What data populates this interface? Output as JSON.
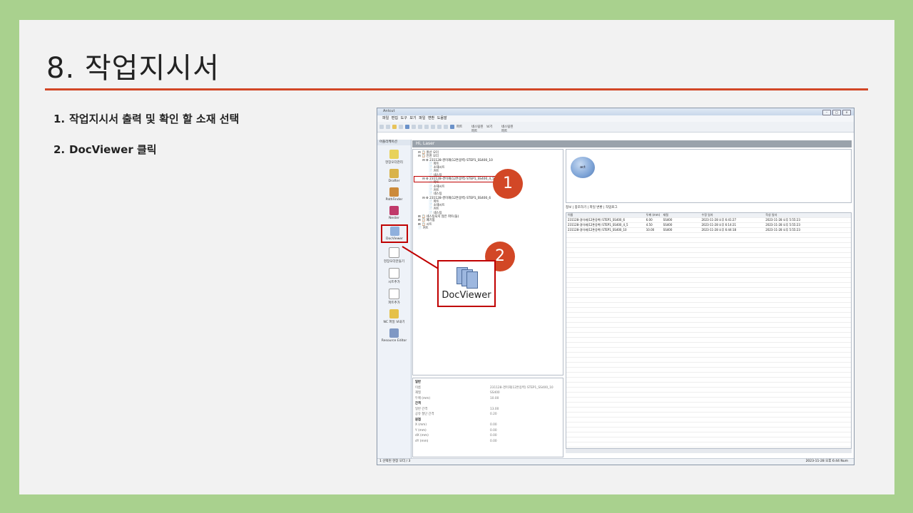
{
  "slide": {
    "title": "8. 작업지시서",
    "steps": [
      {
        "num": "1.",
        "text": "작업지시서 출력 및 확인 할 소재 선택"
      },
      {
        "num": "2.",
        "text": "DocViewer 클릭"
      }
    ]
  },
  "callouts": {
    "one": "1",
    "two": "2",
    "zoom_label": "DocViewer"
  },
  "window": {
    "title": "Antcut",
    "menu": "파일  편집  도구  보기  파일 변환  도움말",
    "toolbar_text": [
      "파트",
      "네스팅된 파트",
      "보기",
      "네스팅된 파트"
    ],
    "left_header": "어플리케이션",
    "apps": [
      "현장오더관리",
      "Drafter",
      "PathFinder",
      "Nester",
      "DocViewer",
      "현장오더만들기",
      "시트추가",
      "파트추가",
      "NC 파일 보내기",
      "Resource Editor"
    ],
    "banner": "Hi, Laser",
    "tree": [
      {
        "level": "l1",
        "text": "⊟ 📋 원산 오더"
      },
      {
        "level": "l1",
        "text": "⊟ 📋 인천 오더"
      },
      {
        "level": "l2",
        "text": "⊟ ⚙ 231128-경이재(12톤옹벽) STEP1_SS400_10"
      },
      {
        "level": "l3",
        "text": "📄 파트"
      },
      {
        "level": "l3",
        "text": "📄 소재시트"
      },
      {
        "level": "l3",
        "text": "📄 커트"
      },
      {
        "level": "l3",
        "text": "📄 네스팅"
      },
      {
        "level": "l2",
        "text": "⊟ ⚙ 231128-경이재(12톤옹벽) STEP1_SS400_4_5",
        "selected": true
      },
      {
        "level": "l3",
        "text": "📄 파트"
      },
      {
        "level": "l3",
        "text": "📄 소재시트"
      },
      {
        "level": "l3",
        "text": "📄 커트"
      },
      {
        "level": "l3",
        "text": "📄 네스팅"
      },
      {
        "level": "l2",
        "text": "⊟ ⚙ 231128-경이재(12톤옹벽) STEP1_SS400_6"
      },
      {
        "level": "l3",
        "text": "📄 파트"
      },
      {
        "level": "l3",
        "text": "📄 소재시트"
      },
      {
        "level": "l3",
        "text": "📄 커트"
      },
      {
        "level": "l3",
        "text": "📄 네스팅"
      },
      {
        "level": "l1",
        "text": "⊞ 📋 네스팅되지 않은 파트(들)"
      },
      {
        "level": "l1",
        "text": "⊞ 📋 폐기됨"
      },
      {
        "level": "l1",
        "text": "⊞ 📋 시트"
      },
      {
        "level": "l1",
        "text": "📄 커트"
      }
    ],
    "props": [
      {
        "k": "일반",
        "v": "",
        "h": true
      },
      {
        "k": "이름",
        "v": "231128-경이재(12톤옹벽) STEP1_SS400_10"
      },
      {
        "k": "재질",
        "v": "SS400"
      },
      {
        "k": "두께 (mm)",
        "v": "10.00"
      },
      {
        "k": "간격",
        "v": "",
        "h": true
      },
      {
        "k": "일반 간격",
        "v": "13.00"
      },
      {
        "k": "공유 절단 간격",
        "v": "0.20"
      },
      {
        "k": "원점",
        "v": "",
        "h": true
      },
      {
        "k": "X (mm)",
        "v": "0.00"
      },
      {
        "k": "Y (mm)",
        "v": "0.00"
      },
      {
        "k": "dX (mm)",
        "v": "0.00"
      },
      {
        "k": "dY (mm)",
        "v": "0.00"
      }
    ],
    "preview_label": "act",
    "tabs": "정보 | 참조하기 | 파일 변환 | 작업로그",
    "grid_head": [
      "이름",
      "두께 (mm)",
      "재질",
      "수정 일자",
      "작성 일자"
    ],
    "grid_rows": [
      [
        "231128-경이재(12톤옹벽) STEP1_SS400_6",
        "6.00",
        "SS400",
        "2023-11-28 오후 6:41:27",
        "2023-11-28 오후 5:55:23"
      ],
      [
        "231128-경이재(12톤옹벽) STEP1_SS400_4_5",
        "4.50",
        "SS400",
        "2023-11-28 오후 6:14:21",
        "2023-11-28 오후 5:55:23"
      ],
      [
        "231128-경이재(12톤옹벽) STEP1_SS400_10",
        "10.00",
        "SS400",
        "2023-11-28 오후 6:44:18",
        "2023-11-28 오후 5:55:23"
      ]
    ],
    "status_left": "1 선택된 현장 오더 / 3",
    "status_right": "2023-11-28 오후 6:44   Num"
  }
}
